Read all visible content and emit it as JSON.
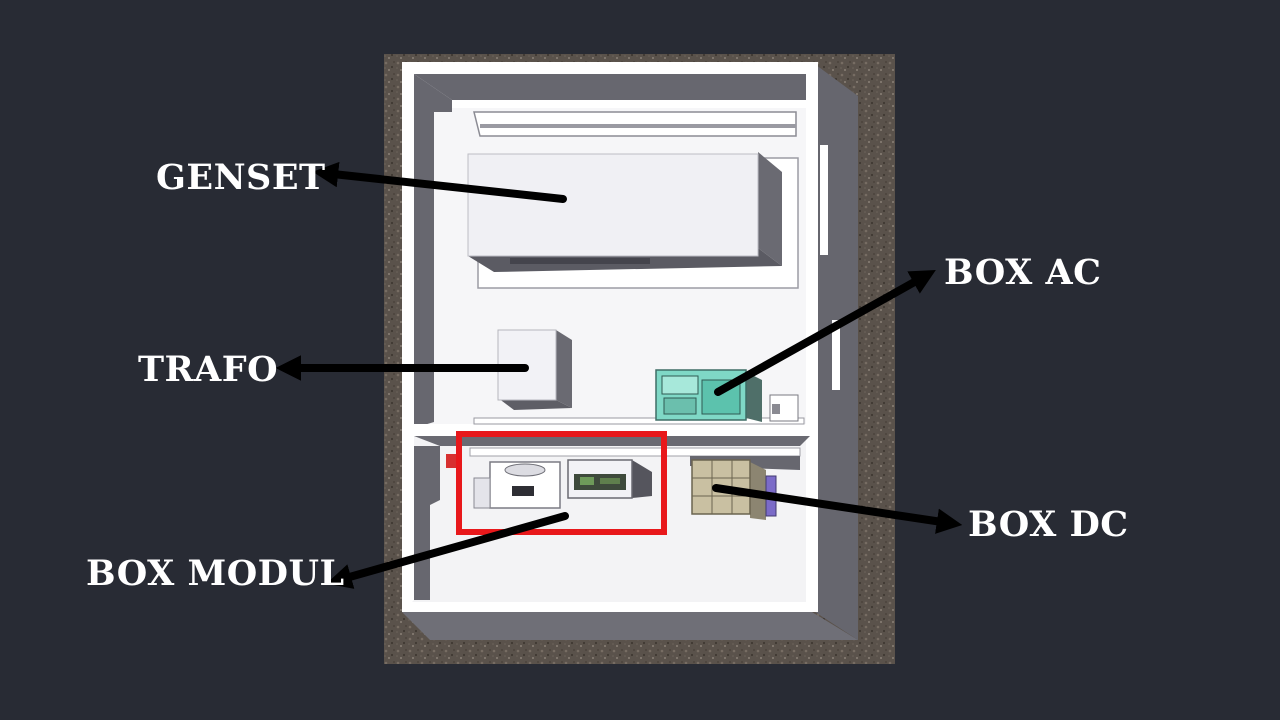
{
  "labels": {
    "genset": "GENSET",
    "trafo": "TRAFO",
    "box_modul": "BOX MODUL",
    "box_ac": "BOX AC",
    "box_dc": "BOX DC"
  },
  "colors": {
    "background": "#282b34",
    "label_text": "#ffffff",
    "arrow": "#000000",
    "highlight_box": "#e8181b",
    "gravel": "#5a524b",
    "wall_top": "#ffffff",
    "wall_side": "#66666e",
    "floor": "#f6f6f8",
    "box_ac_glass": "#7fd8c6",
    "box_dc_frame": "#c9c0a2"
  },
  "icons": {
    "arrows": "arrow-icon"
  }
}
